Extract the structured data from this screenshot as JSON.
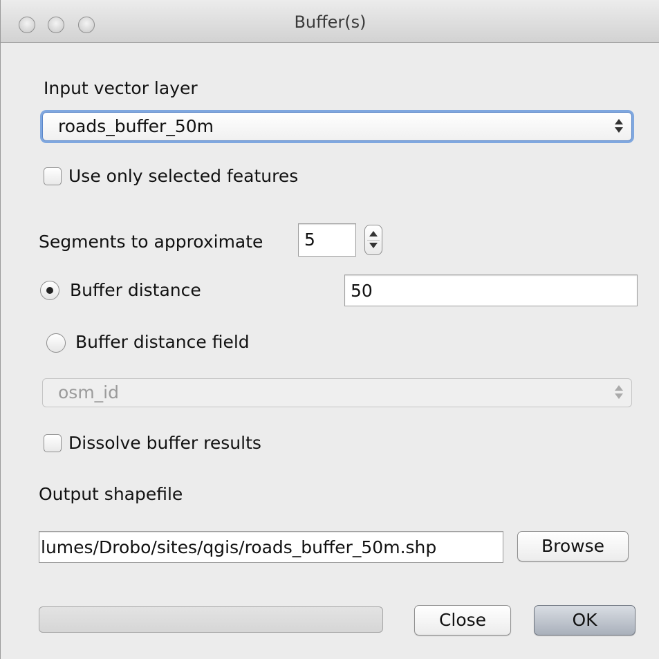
{
  "window": {
    "title": "Buffer(s)"
  },
  "input_layer": {
    "label": "Input vector layer",
    "selected": "roads_buffer_50m"
  },
  "use_selected": {
    "label": "Use only selected features",
    "checked": false
  },
  "segments": {
    "label": "Segments to approximate",
    "value": "5"
  },
  "buffer_distance": {
    "label": "Buffer distance",
    "selected": true,
    "value": "50"
  },
  "buffer_distance_field": {
    "label": "Buffer distance field",
    "selected": false,
    "field_value": "osm_id"
  },
  "dissolve": {
    "label": "Dissolve buffer results",
    "checked": false
  },
  "output": {
    "label": "Output shapefile",
    "path": "lumes/Drobo/sites/qgis/roads_buffer_50m.shp",
    "browse_label": "Browse"
  },
  "progress": {
    "value": 0
  },
  "buttons": {
    "close_label": "Close",
    "ok_label": "OK"
  },
  "colors": {
    "focus_ring": "#7fa7df",
    "window_bg": "#ececec"
  }
}
